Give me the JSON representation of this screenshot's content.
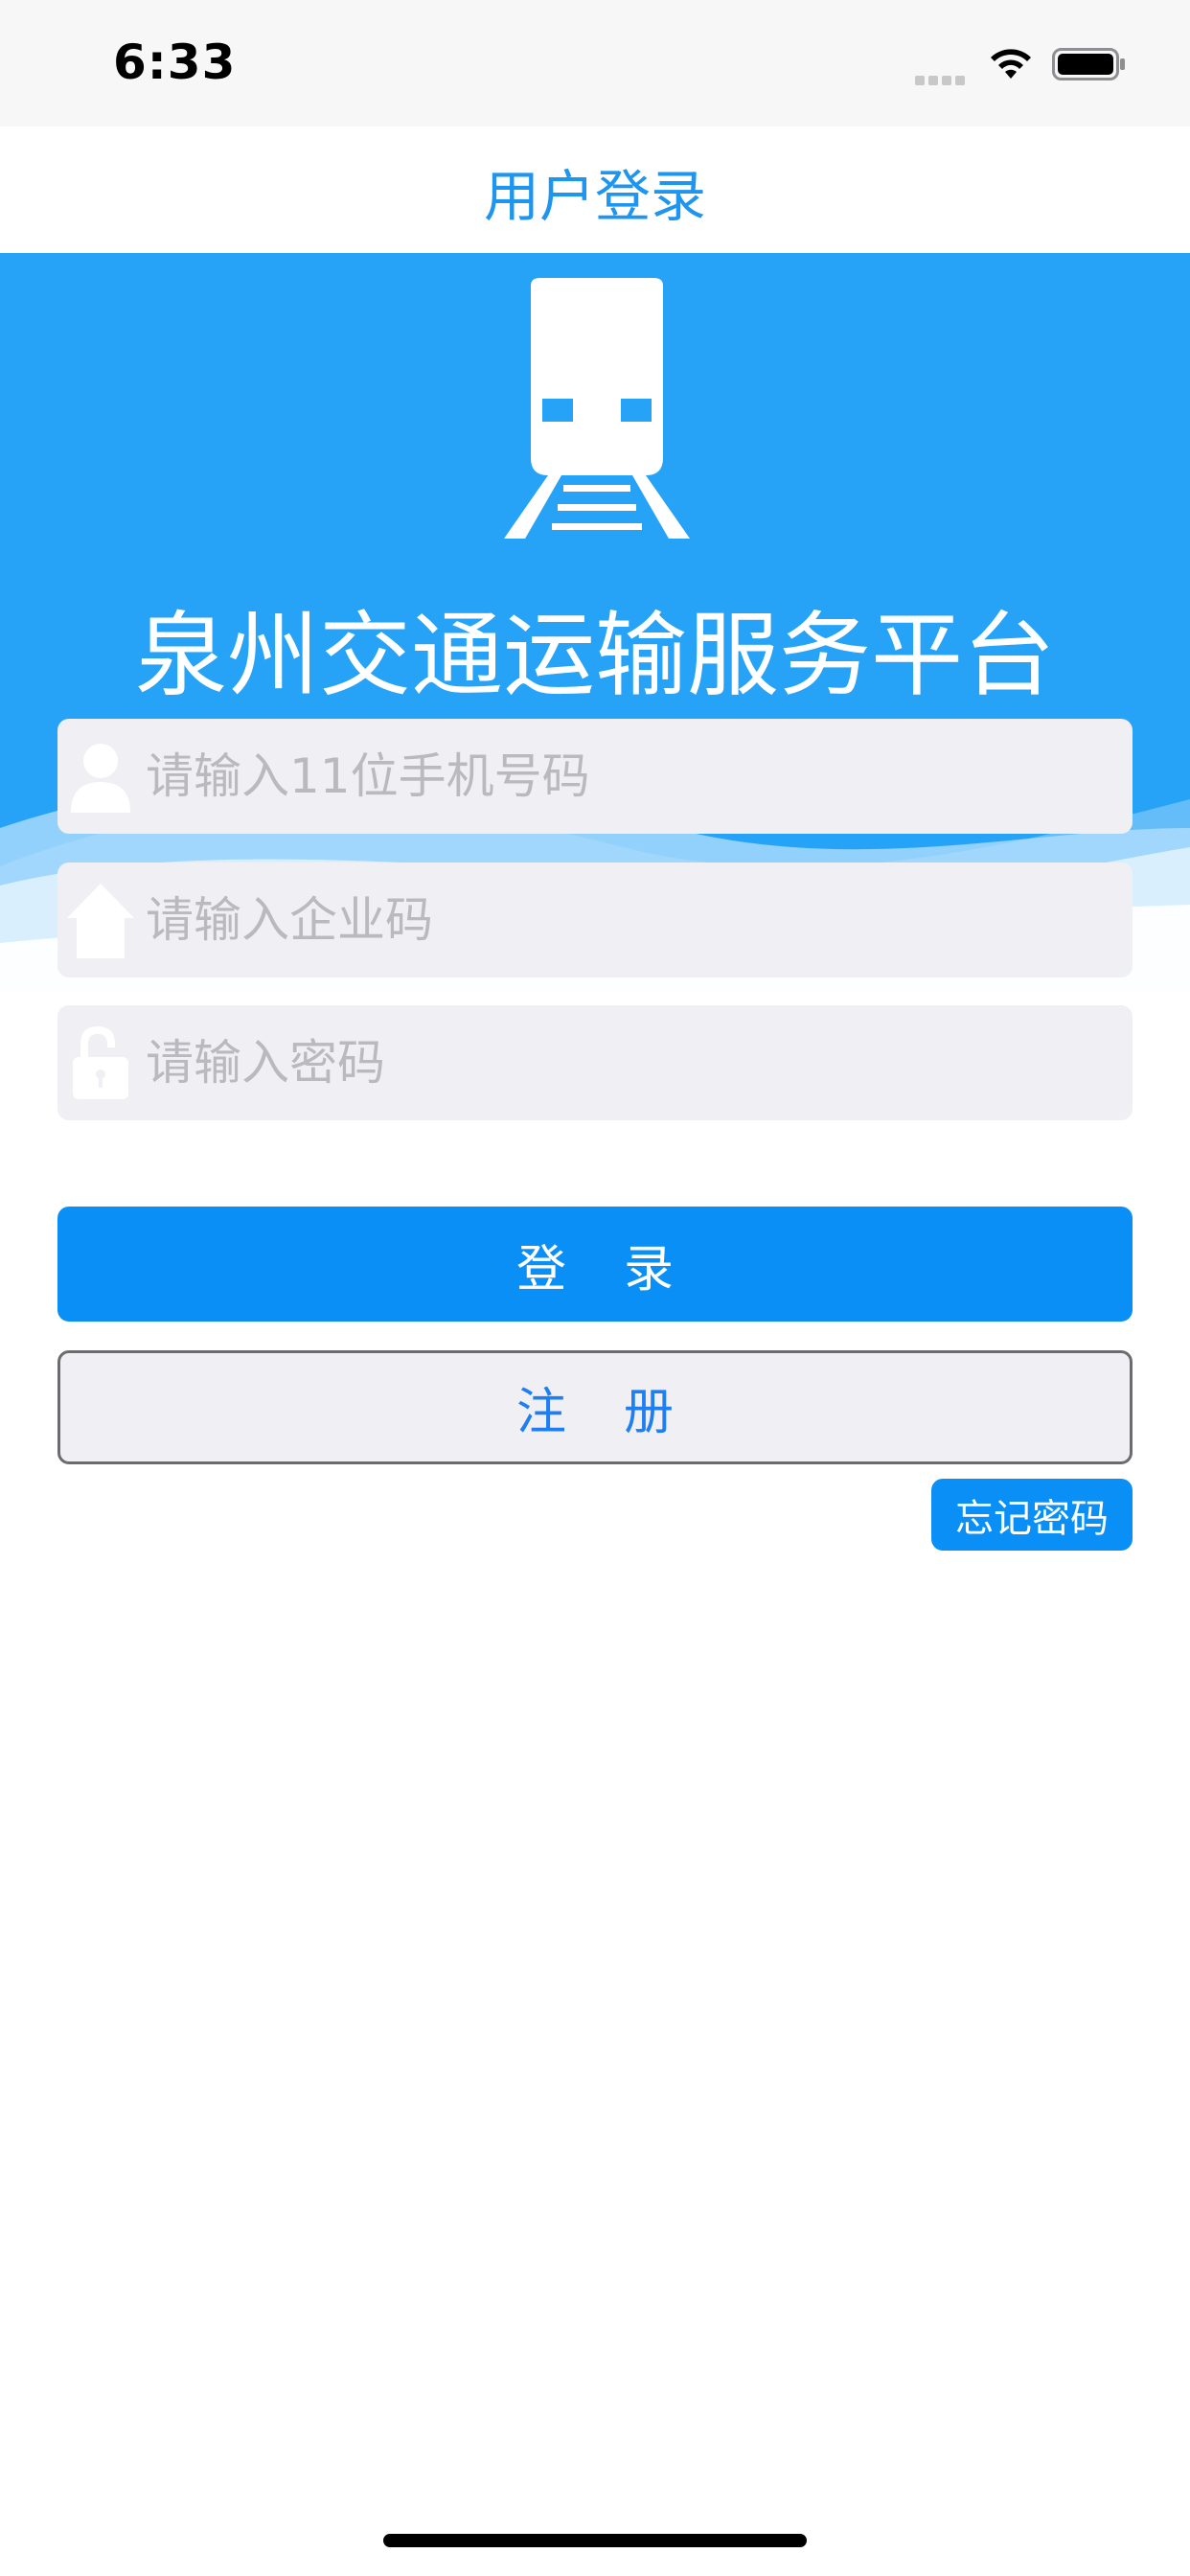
{
  "status_bar": {
    "time": "6:33",
    "icons": [
      "signal-icon",
      "wifi-icon",
      "battery-icon"
    ]
  },
  "nav": {
    "title": "用户登录"
  },
  "hero": {
    "icon": "train-icon",
    "title": "泉州交通运输服务平台"
  },
  "form": {
    "phone": {
      "icon": "user-icon",
      "value": "",
      "placeholder": "请输入11位手机号码"
    },
    "company": {
      "icon": "home-icon",
      "value": "",
      "placeholder": "请输入企业码"
    },
    "password": {
      "icon": "unlock-icon",
      "value": "",
      "placeholder": "请输入密码"
    }
  },
  "buttons": {
    "login": "登录",
    "register": "注册",
    "forgot": "忘记密码"
  },
  "colors": {
    "accent": "#0a8ff7",
    "hero_background": "#26a3f7",
    "nav_title": "#1e96f0",
    "field_background": "#efeff4",
    "register_text": "#1e7ff2"
  }
}
